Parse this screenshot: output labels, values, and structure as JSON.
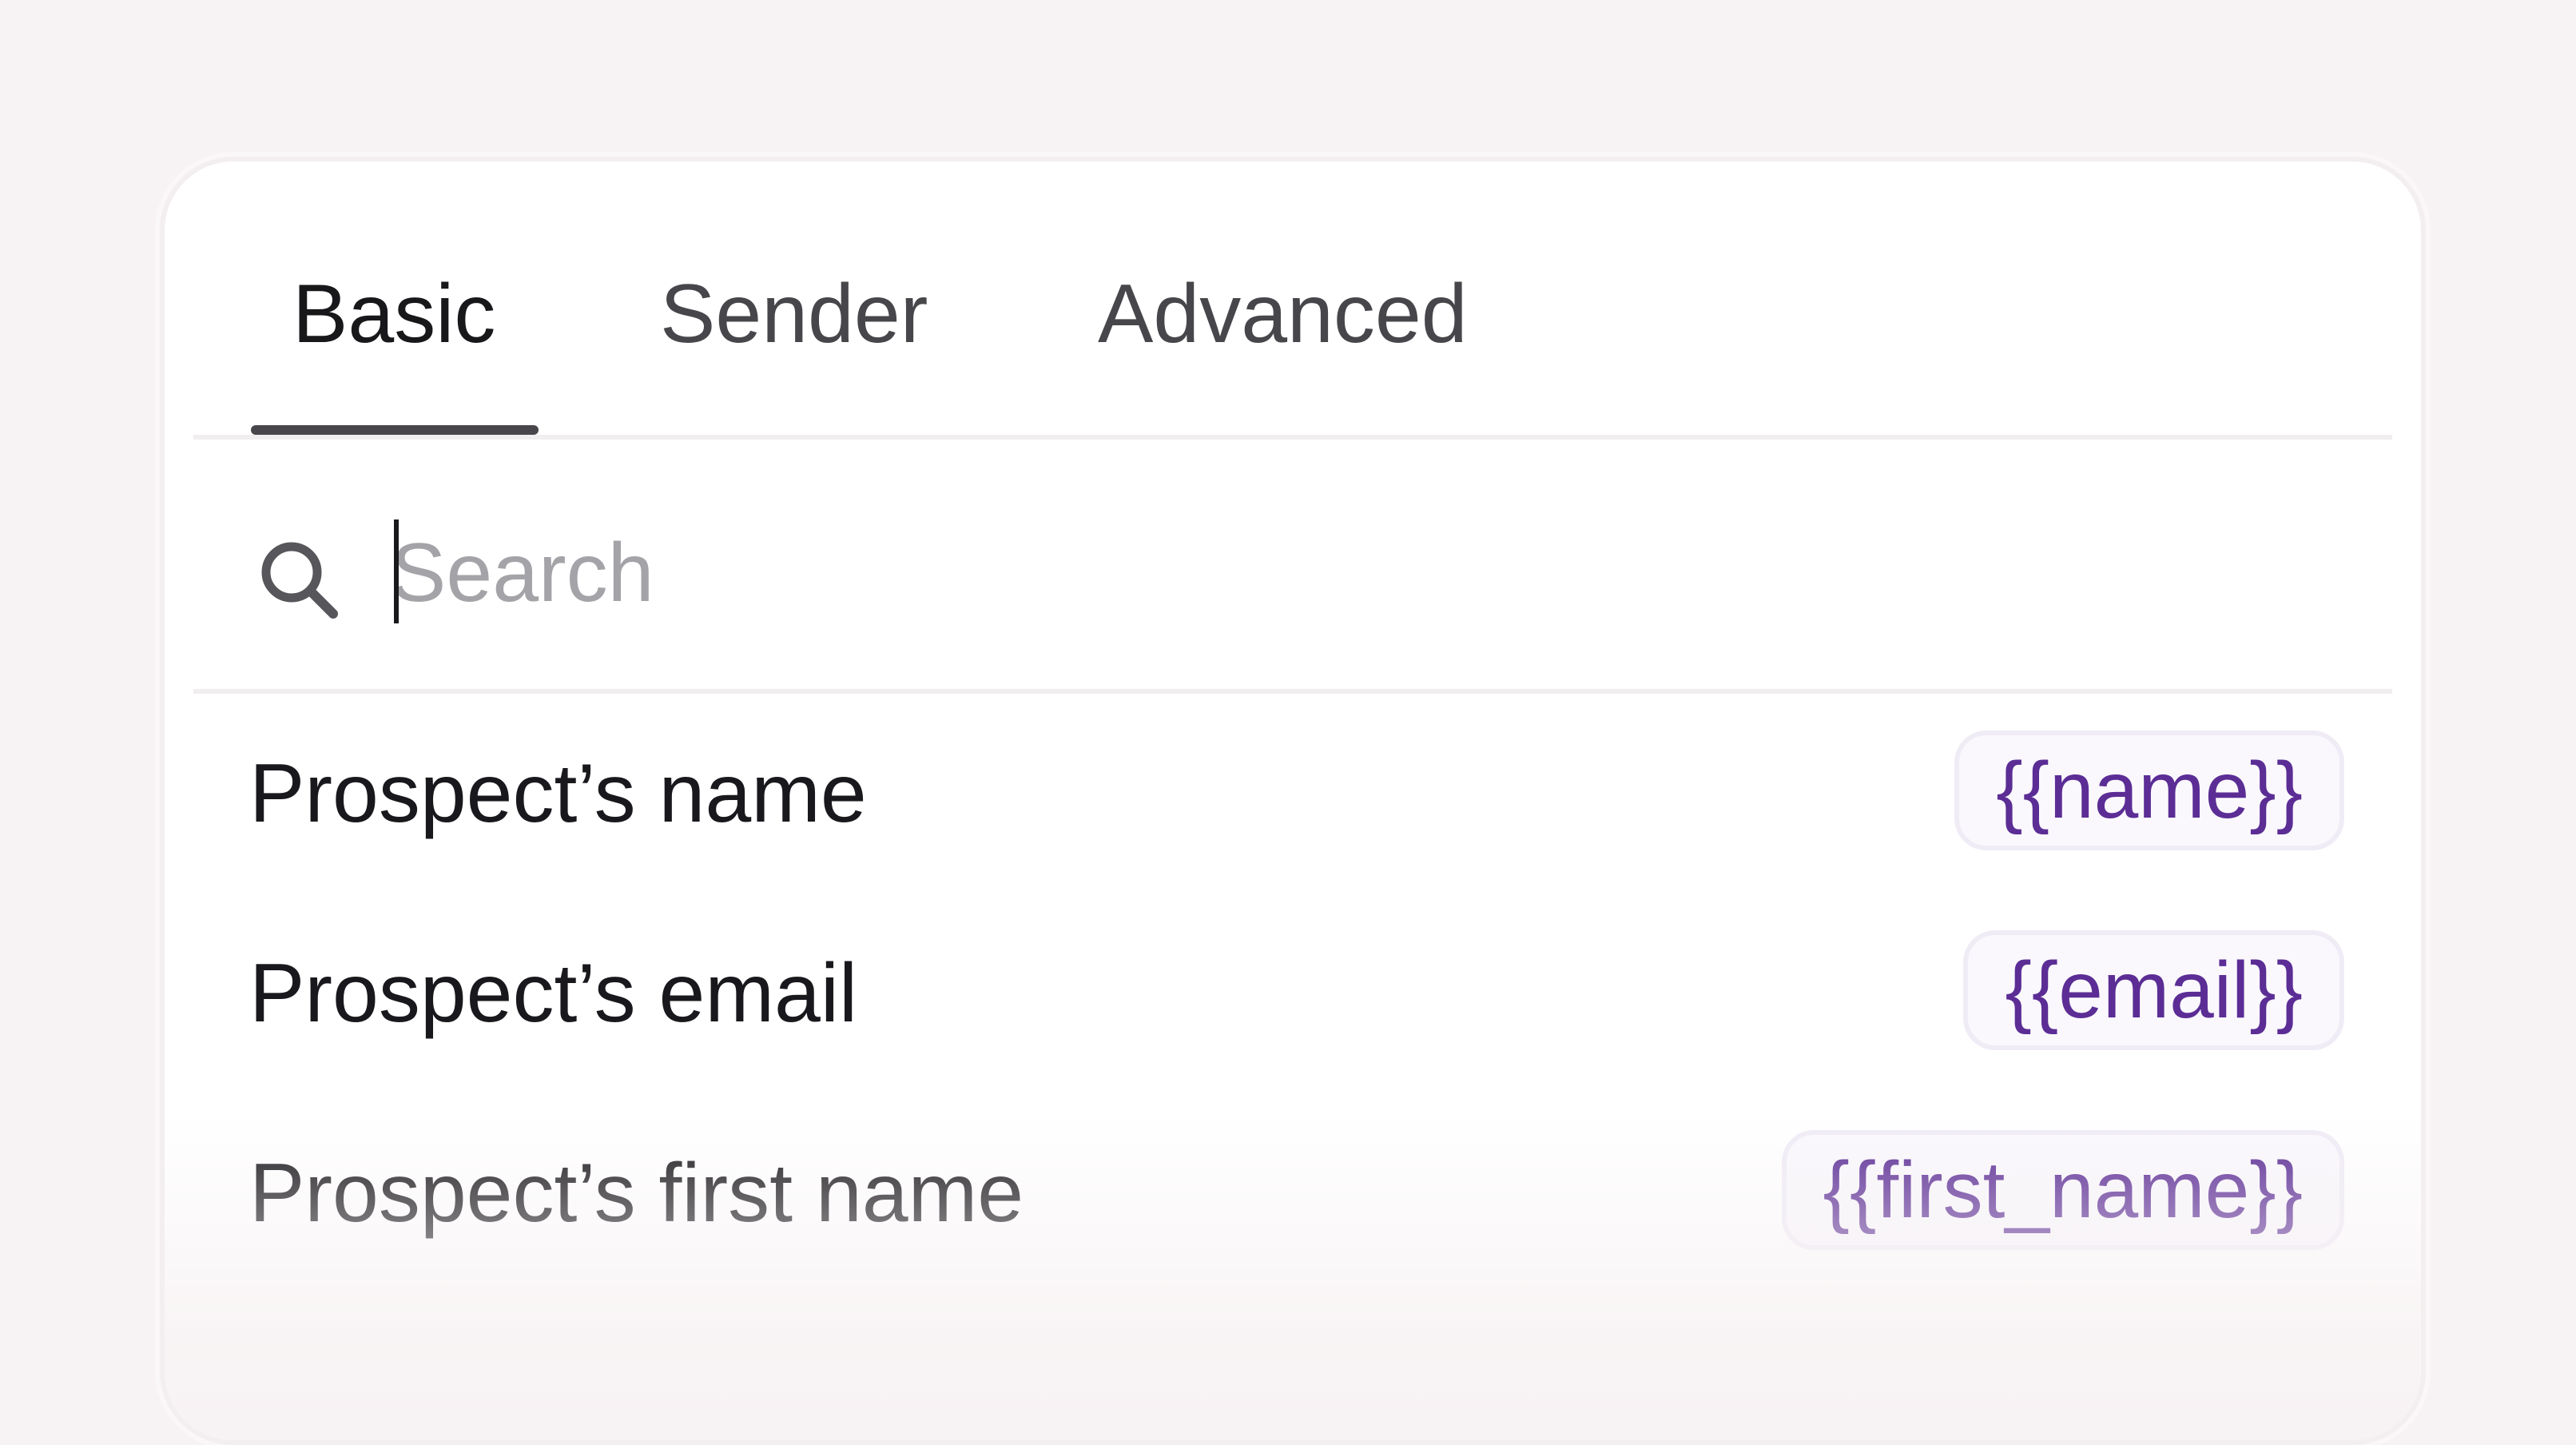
{
  "tabs": [
    {
      "label": "Basic",
      "active": true
    },
    {
      "label": "Sender",
      "active": false
    },
    {
      "label": "Advanced",
      "active": false
    }
  ],
  "search": {
    "placeholder": "Search",
    "value": ""
  },
  "variables": [
    {
      "label": "Prospect’s name",
      "token": "{{name}}"
    },
    {
      "label": "Prospect’s email",
      "token": "{{email}}"
    },
    {
      "label": "Prospect’s first name",
      "token": "{{first_name}}"
    }
  ],
  "colors": {
    "background": "#f7f2f3",
    "token_text": "#5b2d95",
    "tab_underline": "#48464a"
  }
}
